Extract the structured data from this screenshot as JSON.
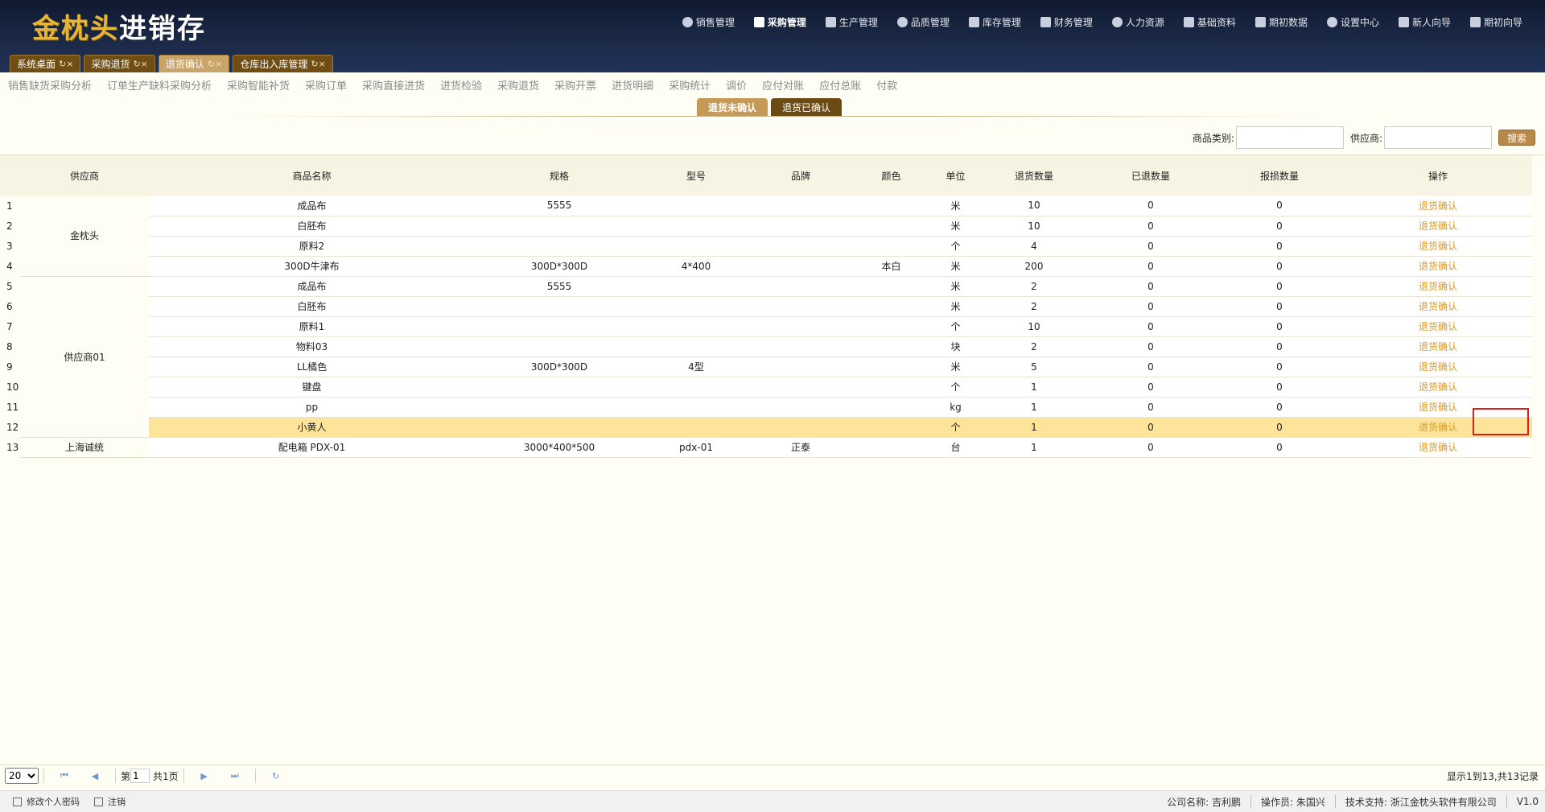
{
  "app": {
    "logo_part1": "金枕头",
    "logo_part2": "进销存"
  },
  "topnav": [
    {
      "label": "销售管理",
      "icon": "clock-icon"
    },
    {
      "label": "采购管理",
      "icon": "cart-icon",
      "active": true
    },
    {
      "label": "生产管理",
      "icon": "gear-icon"
    },
    {
      "label": "品质管理",
      "icon": "shield-icon"
    },
    {
      "label": "库存管理",
      "icon": "grid-icon"
    },
    {
      "label": "财务管理",
      "icon": "yen-icon"
    },
    {
      "label": "人力资源",
      "icon": "users-icon"
    },
    {
      "label": "基础资料",
      "icon": "book-icon"
    },
    {
      "label": "期初数据",
      "icon": "database-icon"
    },
    {
      "label": "设置中心",
      "icon": "sliders-icon"
    },
    {
      "label": "新人向导",
      "icon": "guide-icon"
    },
    {
      "label": "期初向导",
      "icon": "puzzle-icon"
    }
  ],
  "tabs": [
    {
      "label": "系统桌面",
      "active": false
    },
    {
      "label": "采购退货",
      "active": false
    },
    {
      "label": "退货确认",
      "active": true
    },
    {
      "label": "仓库出入库管理",
      "active": false
    }
  ],
  "submenu": [
    "销售缺货采购分析",
    "订单生产缺料采购分析",
    "采购智能补货",
    "采购订单",
    "采购直接进货",
    "进货检验",
    "采购退货",
    "采购开票",
    "进货明细",
    "采购统计",
    "调价",
    "应付对账",
    "应付总账",
    "付款"
  ],
  "subtabs": {
    "unconfirmed": "退货未确认",
    "confirmed": "退货已确认"
  },
  "search": {
    "category_label": "商品类别:",
    "category_value": "",
    "supplier_label": "供应商:",
    "supplier_value": "",
    "button": "搜索"
  },
  "table": {
    "headers": [
      "供应商",
      "商品名称",
      "规格",
      "型号",
      "品牌",
      "颜色",
      "单位",
      "退货数量",
      "已退数量",
      "报损数量",
      "操作"
    ],
    "groups": [
      {
        "supplier": "金枕头",
        "rows": [
          {
            "n": "1",
            "name": "成品布",
            "spec": "5555",
            "model": "",
            "brand": "",
            "color": "",
            "unit": "米",
            "qty": "10",
            "returned": "0",
            "loss": "0",
            "op": "退货确认"
          },
          {
            "n": "2",
            "name": "白胚布",
            "spec": "",
            "model": "",
            "brand": "",
            "color": "",
            "unit": "米",
            "qty": "10",
            "returned": "0",
            "loss": "0",
            "op": "退货确认"
          },
          {
            "n": "3",
            "name": "原料2",
            "spec": "",
            "model": "",
            "brand": "",
            "color": "",
            "unit": "个",
            "qty": "4",
            "returned": "0",
            "loss": "0",
            "op": "退货确认"
          },
          {
            "n": "4",
            "name": "300D牛津布",
            "spec": "300D*300D",
            "model": "4*400",
            "brand": "",
            "color": "本白",
            "unit": "米",
            "qty": "200",
            "returned": "0",
            "loss": "0",
            "op": "退货确认"
          }
        ]
      },
      {
        "supplier": "供应商01",
        "rows": [
          {
            "n": "5",
            "name": "成品布",
            "spec": "5555",
            "model": "",
            "brand": "",
            "color": "",
            "unit": "米",
            "qty": "2",
            "returned": "0",
            "loss": "0",
            "op": "退货确认"
          },
          {
            "n": "6",
            "name": "白胚布",
            "spec": "",
            "model": "",
            "brand": "",
            "color": "",
            "unit": "米",
            "qty": "2",
            "returned": "0",
            "loss": "0",
            "op": "退货确认"
          },
          {
            "n": "7",
            "name": "原料1",
            "spec": "",
            "model": "",
            "brand": "",
            "color": "",
            "unit": "个",
            "qty": "10",
            "returned": "0",
            "loss": "0",
            "op": "退货确认"
          },
          {
            "n": "8",
            "name": "物料03",
            "spec": "",
            "model": "",
            "brand": "",
            "color": "",
            "unit": "块",
            "qty": "2",
            "returned": "0",
            "loss": "0",
            "op": "退货确认"
          },
          {
            "n": "9",
            "name": "LL橘色",
            "spec": "300D*300D",
            "model": "4型",
            "brand": "",
            "color": "",
            "unit": "米",
            "qty": "5",
            "returned": "0",
            "loss": "0",
            "op": "退货确认"
          },
          {
            "n": "10",
            "name": "键盘",
            "spec": "",
            "model": "",
            "brand": "",
            "color": "",
            "unit": "个",
            "qty": "1",
            "returned": "0",
            "loss": "0",
            "op": "退货确认"
          },
          {
            "n": "11",
            "name": "pp",
            "spec": "",
            "model": "",
            "brand": "",
            "color": "",
            "unit": "kg",
            "qty": "1",
            "returned": "0",
            "loss": "0",
            "op": "退货确认"
          },
          {
            "n": "12",
            "name": "小黄人",
            "spec": "",
            "model": "",
            "brand": "",
            "color": "",
            "unit": "个",
            "qty": "1",
            "returned": "0",
            "loss": "0",
            "op": "退货确认",
            "highlight": true
          }
        ]
      },
      {
        "supplier": "上海诚统",
        "rows": [
          {
            "n": "13",
            "name": "配电箱 PDX-01",
            "spec": "3000*400*500",
            "model": "pdx-01",
            "brand": "正泰",
            "color": "",
            "unit": "台",
            "qty": "1",
            "returned": "0",
            "loss": "0",
            "op": "退货确认"
          }
        ]
      }
    ]
  },
  "pager": {
    "page_size": "20",
    "page_prefix": "第",
    "page_value": "1",
    "total_pages": "共1页",
    "summary": "显示1到13,共13记录"
  },
  "statusbar": {
    "change_password": "修改个人密码",
    "logout": "注销",
    "company": "公司名称: 吉利鹏",
    "operator": "操作员: 朱国兴",
    "support": "技术支持: 浙江金枕头软件有限公司",
    "version": "V1.0"
  }
}
